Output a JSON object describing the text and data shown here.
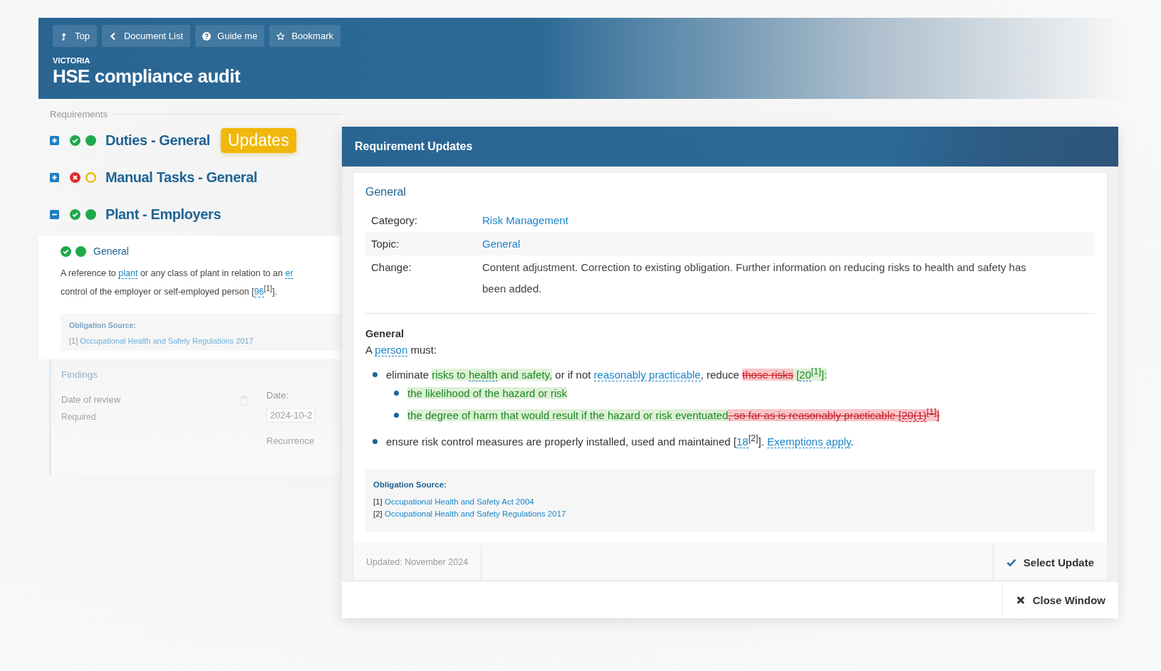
{
  "toolbar": [
    {
      "label": "Top"
    },
    {
      "label": "Document List"
    },
    {
      "label": "Guide me"
    },
    {
      "label": "Bookmark"
    }
  ],
  "header": {
    "region": "VICTORIA",
    "title": "HSE compliance audit"
  },
  "requirements": {
    "label": "Requirements",
    "groups": [
      {
        "title": "Duties - General",
        "passed": true,
        "complete": true,
        "expanded": false,
        "badge": "Updates"
      },
      {
        "title": "Manual Tasks - General",
        "passed": false,
        "complete": false,
        "expanded": false
      },
      {
        "title": "Plant - Employers",
        "passed": true,
        "complete": true,
        "expanded": true,
        "obligation": {
          "title": "General",
          "passed": true,
          "complete": true,
          "lines": [
            [
              {
                "text": "A reference to "
              },
              {
                "text": "plant",
                "link": true
              },
              {
                "text": " or any class of plant in relation to an "
              },
              {
                "text": "er",
                "link": true
              }
            ],
            [
              {
                "text": "control of the employer or self-employed person ["
              },
              {
                "text": "96",
                "link": true
              },
              {
                "text": "$^{[1]}$]."
              }
            ]
          ],
          "source_label": "Obligation Source:",
          "sources": [
            {
              "ref": "[1]",
              "title": "Occupational Health and Safety Regulations 2017"
            }
          ],
          "findings": {
            "title": "Findings",
            "field_label": "Date of review",
            "field_hint": "Required",
            "date_label": "Date:",
            "date_value": "2024-10-2",
            "recurrence_label": "Recurrence"
          }
        }
      }
    ]
  },
  "modal": {
    "title": "Requirement Updates",
    "heading": "General",
    "details": [
      {
        "label": "Category:",
        "value": "Risk Management",
        "link": true
      },
      {
        "label": "Topic:",
        "value": "General",
        "link": true
      },
      {
        "label": "Change:",
        "value": "Content adjustment. Correction to existing obligation. Further information on reducing risks to health and safety has been added.",
        "link": false
      }
    ],
    "section_title": "General",
    "intro": [
      {
        "text": "A "
      },
      {
        "text": "person",
        "link": true
      },
      {
        "text": " must:"
      }
    ],
    "bullets": [
      {
        "segments": [
          {
            "text": "eliminate "
          },
          {
            "text": "risks to ",
            "added": true
          },
          {
            "text": "health",
            "link": true,
            "added": true
          },
          {
            "text": " and safety,",
            "added": true
          },
          {
            "text": " or if not "
          },
          {
            "text": "reasonably practicable",
            "link": true
          },
          {
            "text": ", reduce "
          },
          {
            "text": "those risks",
            "removed": true
          },
          {
            "text": " [",
            "added": true
          },
          {
            "text": "20",
            "link": true,
            "added": true
          },
          {
            "text": "$^{[1]}$]:",
            "added": true
          }
        ],
        "children": [
          {
            "segments": [
              {
                "text": "the likelihood of the hazard or risk",
                "added": true
              }
            ]
          },
          {
            "segments": [
              {
                "text": "the degree of harm that would result if the hazard or risk eventuated",
                "added": true
              },
              {
                "text": ", so far as is reasonably practicable [",
                "removed": true
              },
              {
                "text": "20(1)",
                "link": true,
                "removed": true
              },
              {
                "text": "$^{[1]}$]",
                "removed": true
              }
            ]
          }
        ]
      },
      {
        "segments": [
          {
            "text": "ensure risk control measures are properly installed, used and maintained ["
          },
          {
            "text": "18",
            "link": true
          },
          {
            "text": "$^{[2]}$]. "
          },
          {
            "text": "Exemptions apply",
            "link": true
          },
          {
            "text": "."
          }
        ]
      }
    ],
    "source_label": "Obligation Source:",
    "sources": [
      {
        "ref": "[1]",
        "title": "Occupational Health and Safety Act 2004"
      },
      {
        "ref": "[2]",
        "title": "Occupational Health and Safety Regulations 2017"
      }
    ],
    "updated": "Updated: November 2024",
    "select": "Select Update",
    "close": "Close Window"
  }
}
